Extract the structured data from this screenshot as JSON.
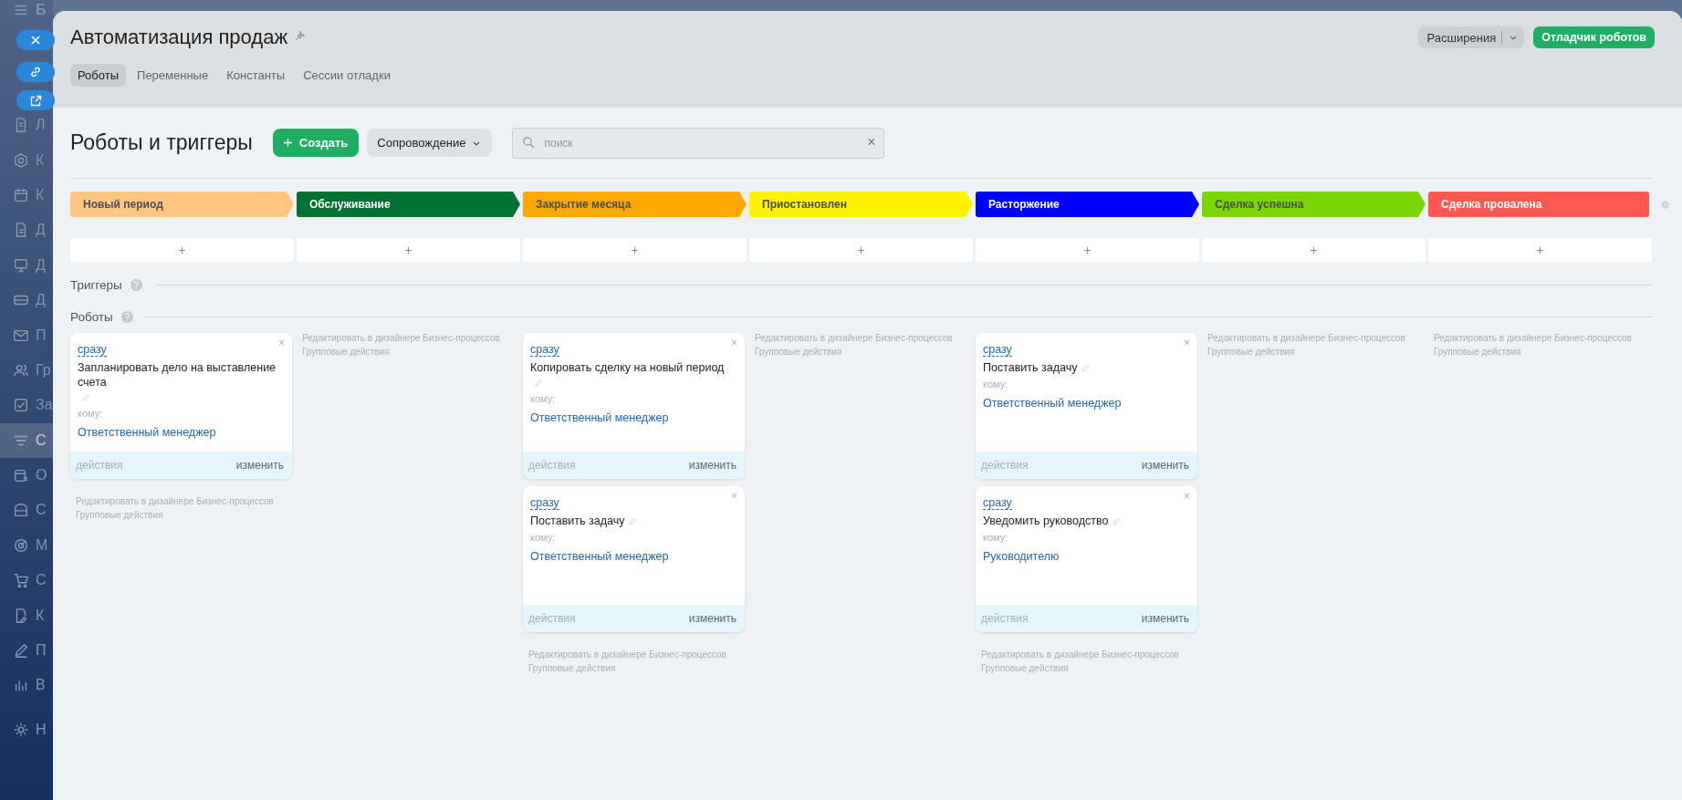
{
  "sidebar": {
    "items": [
      {
        "label": "Б",
        "selected": false
      },
      {
        "label": "Л",
        "selected": false
      },
      {
        "label": "К",
        "selected": false
      },
      {
        "label": "К",
        "selected": false
      },
      {
        "label": "Д",
        "selected": false
      },
      {
        "label": "Д",
        "selected": false
      },
      {
        "label": "Д",
        "selected": false
      },
      {
        "label": "П",
        "selected": false
      },
      {
        "label": "Гр",
        "selected": false
      },
      {
        "label": "За",
        "selected": false
      },
      {
        "label": "С",
        "selected": true
      },
      {
        "label": "О",
        "selected": false
      },
      {
        "label": "С",
        "selected": false
      },
      {
        "label": "М",
        "selected": false
      },
      {
        "label": "С",
        "selected": false
      },
      {
        "label": "К",
        "selected": false
      },
      {
        "label": "П",
        "selected": false
      },
      {
        "label": "В",
        "selected": false
      },
      {
        "label": "Н",
        "selected": false
      }
    ]
  },
  "panel": {
    "title": "Автоматизация продаж",
    "tabs": [
      {
        "label": "Роботы",
        "selected": true
      },
      {
        "label": "Переменные",
        "selected": false
      },
      {
        "label": "Константы",
        "selected": false
      },
      {
        "label": "Сессии отладки",
        "selected": false
      }
    ],
    "extensions_button": "Расширения",
    "debugger_button": "Отладчик роботов"
  },
  "toolbar": {
    "title": "Роботы и триггеры",
    "create_button": "Создать",
    "mode_dropdown": "Сопровождение",
    "search": {
      "placeholder": "поиск"
    },
    "clear": "×"
  },
  "stages": [
    {
      "name": "Новый период",
      "color": "#ffc682",
      "add_button": "+"
    },
    {
      "name": "Обслуживание",
      "color": "#007233",
      "add_button": "+"
    },
    {
      "name": "Закрытие месяца",
      "color": "#ffa900",
      "add_button": "+"
    },
    {
      "name": "Приостановлен",
      "color": "#fff200",
      "add_button": "+"
    },
    {
      "name": "Расторжение",
      "color": "#0000ff",
      "add_button": "+"
    },
    {
      "name": "Сделка успешна",
      "color": "#7bd500",
      "add_button": "+"
    },
    {
      "name": "Сделка провалена",
      "color": "#ff5752",
      "add_button": "+"
    }
  ],
  "triggers_label": "Триггеры",
  "triggers_help": "?",
  "robots_label": "Роботы",
  "robots_help": "?",
  "columns": [
    {
      "robots": [
        {
          "delay": "сразу",
          "title": "Запланировать дело на выставление счета",
          "recipient_label": "кому:",
          "recipient": "Ответственный менеджер",
          "actions": "действия",
          "edit": "изменить",
          "close": "×"
        }
      ],
      "designer_link": "Редактировать в дизайнере Бизнес-процессов",
      "group_actions": "Групповые действия"
    },
    {
      "designer_link": "Редактировать в дизайнере Бизнес-процессов",
      "group_actions": "Групповые действия"
    },
    {
      "robots": [
        {
          "delay": "сразу",
          "title": "Копировать сделку на новый период",
          "recipient_label": "кому:",
          "recipient": "Ответственный менеджер",
          "actions": "действия",
          "edit": "изменить",
          "close": "×"
        },
        {
          "delay": "сразу",
          "title": "Поставить задачу",
          "recipient_label": "кому:",
          "recipient": "Ответственный менеджер",
          "actions": "действия",
          "edit": "изменить",
          "close": "×"
        }
      ],
      "designer_link": "Редактировать в дизайнере Бизнес-процессов",
      "group_actions": "Групповые действия"
    },
    {
      "designer_link": "Редактировать в дизайнере Бизнес-процессов",
      "group_actions": "Групповые действия"
    },
    {
      "robots": [
        {
          "delay": "сразу",
          "title": "Поставить задачу",
          "recipient_label": "кому:",
          "recipient": "Ответственный менеджер",
          "actions": "действия",
          "edit": "изменить",
          "close": "×"
        },
        {
          "delay": "сразу",
          "title": "Уведомить руководство",
          "recipient_label": "кому:",
          "recipient": "Руководителю",
          "actions": "действия",
          "edit": "изменить",
          "close": "×"
        }
      ],
      "designer_link": "Редактировать в дизайнере Бизнес-процессов",
      "group_actions": "Групповые действия"
    },
    {
      "designer_link": "Редактировать в дизайнере Бизнес-процессов",
      "group_actions": "Групповые действия"
    },
    {
      "designer_link": "Редактировать в дизайнере Бизнес-процессов",
      "group_actions": "Групповые действия"
    }
  ]
}
